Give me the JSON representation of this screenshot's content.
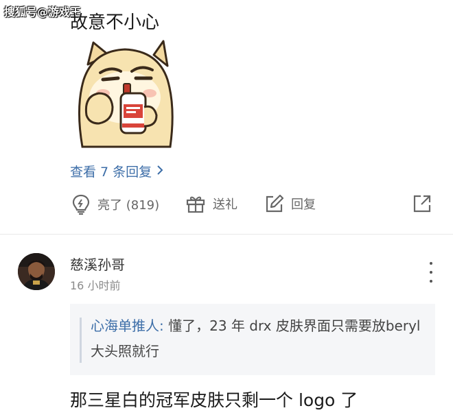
{
  "watermark": "搜狐号@游戏王",
  "previous_comment": {
    "text": "故意不小心",
    "view_replies_label": "查看 7 条回复",
    "actions": {
      "like_label": "亮了 (819)",
      "gift_label": "送礼",
      "reply_label": "回复"
    }
  },
  "comment": {
    "username": "慈溪孙哥",
    "time": "16 小时前",
    "quote": {
      "author": "心海单推人:",
      "text": " 懂了，23 年 drx 皮肤界面只需要放beryl 大头照就行"
    },
    "body": "那三星白的冠军皮肤只剩一个 logo 了"
  },
  "colors": {
    "link": "#3d6ea8",
    "muted": "#8a8a8a",
    "quote_bg": "#f5f6f8"
  },
  "icons": [
    "lightbulb-icon",
    "gift-icon",
    "edit-icon",
    "share-icon",
    "chevron-right-icon",
    "more-vertical-icon"
  ]
}
